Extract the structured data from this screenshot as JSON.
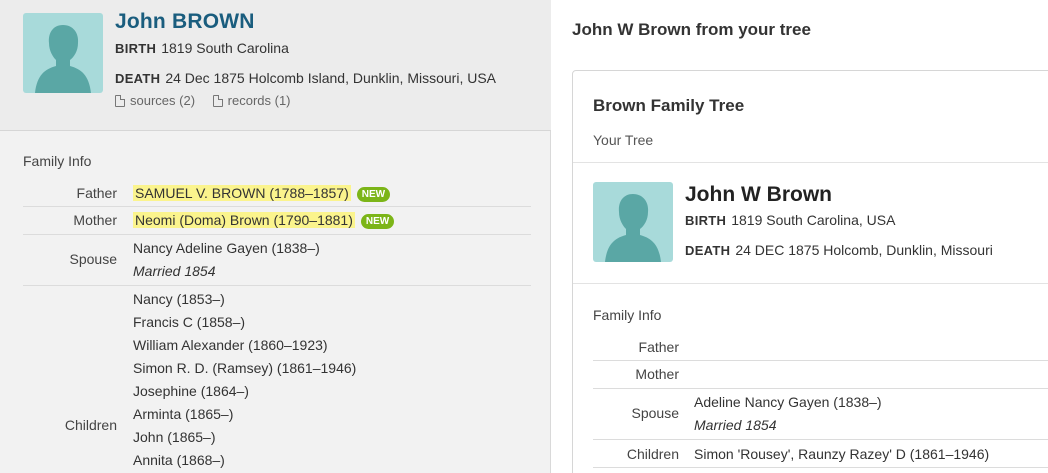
{
  "left": {
    "person": {
      "name": "John BROWN",
      "birth_label": "BIRTH",
      "birth_value": "1819 South Carolina",
      "death_label": "DEATH",
      "death_value": "24 Dec 1875 Holcomb Island, Dunklin, Missouri, USA",
      "sources": "sources (2)",
      "records": "records (1)"
    },
    "family_info_label": "Family Info",
    "family": {
      "father_label": "Father",
      "father": "SAMUEL V. BROWN (1788–1857)",
      "father_badge": "NEW",
      "mother_label": "Mother",
      "mother": "Neomi (Doma) Brown (1790–1881)",
      "mother_badge": "NEW",
      "spouse_label": "Spouse",
      "spouse": "Nancy Adeline Gayen (1838–)",
      "married": "Married 1854",
      "children_label": "Children",
      "children": [
        "Nancy (1853–)",
        "Francis C (1858–)",
        "William Alexander (1860–1923)",
        "Simon R. D. (Ramsey) (1861–1946)",
        "Josephine (1864–)",
        "Arminta (1865–)",
        "John (1865–)",
        "Annita (1868–)"
      ]
    }
  },
  "right": {
    "title": "John W Brown from your tree",
    "tree_name": "Brown Family Tree",
    "tree_sub": "Your Tree",
    "person": {
      "name": "John W Brown",
      "birth_label": "BIRTH",
      "birth_value": "1819 South Carolina, USA",
      "death_label": "DEATH",
      "death_value": "24 DEC 1875 Holcomb, Dunklin, Missouri"
    },
    "family_info_label": "Family Info",
    "family": {
      "father_label": "Father",
      "mother_label": "Mother",
      "spouse_label": "Spouse",
      "spouse": "Adeline Nancy Gayen (1838–)",
      "married": "Married 1854",
      "children_label": "Children",
      "children_first": "Simon 'Rousey', Raunzy Razey' D (1861–1946)"
    }
  },
  "icons": {
    "avatar": "person-silhouette-icon",
    "document": "document-icon"
  },
  "colors": {
    "name_link": "#1a5d7e",
    "highlight": "#fbf48d",
    "new_badge": "#7cb518",
    "avatar_bg": "#a8dada",
    "avatar_fg": "#5aa7a5"
  }
}
